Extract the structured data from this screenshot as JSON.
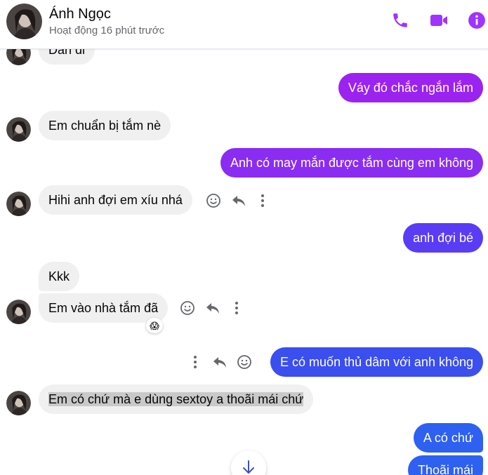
{
  "header": {
    "contact_name": "Ánh Ngọc",
    "status": "Hoạt động 16 phút trước",
    "icons": [
      "phone-icon",
      "video-camera-icon",
      "info-icon"
    ],
    "accent_color": "#a033ff"
  },
  "messages": [
    {
      "side": "in",
      "text": "Dan di"
    },
    {
      "side": "out",
      "text": "Váy đó chắc ngắn lắm",
      "color": "#9b22f0"
    },
    {
      "side": "in",
      "text": "Em chuẩn bị tắm nè"
    },
    {
      "side": "out",
      "text": "Anh có may mắn được tắm cùng em không",
      "color": "#8a2cf2"
    },
    {
      "side": "in",
      "text": "Hihi anh đợi em xíu nhá"
    },
    {
      "side": "out",
      "text": "anh đợi bé",
      "color": "#5a3cf5"
    },
    {
      "side": "in",
      "text": "Kkk"
    },
    {
      "side": "in",
      "text": "Em vào nhà tắm đã",
      "reaction": "😱"
    },
    {
      "side": "out",
      "text": "E có muốn thủ dâm với anh không",
      "color": "#3b4ef0"
    },
    {
      "side": "in",
      "text": "Em có chứ mà e dùng sextoy a thoãi mái chứ",
      "selected": true
    },
    {
      "side": "out",
      "text": "A có chứ",
      "color": "#2e60f2"
    },
    {
      "side": "out",
      "text": "Thoãi mái",
      "color": "#2e60f2"
    }
  ],
  "message_actions": [
    "react-icon",
    "reply-icon",
    "more-options-icon"
  ],
  "scroll_down_icon": "arrow-down-icon"
}
